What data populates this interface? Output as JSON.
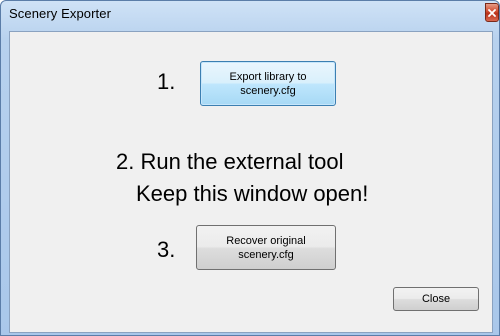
{
  "window": {
    "title": "Scenery Exporter"
  },
  "steps": {
    "step1_number": "1.",
    "export_button_line1": "Export library to",
    "export_button_line2": "scenery.cfg",
    "step2_line1": "2. Run the external tool",
    "step2_line2": "Keep this window open!",
    "step3_number": "3.",
    "recover_button_line1": "Recover original",
    "recover_button_line2": "scenery.cfg"
  },
  "footer": {
    "close_label": "Close"
  },
  "icons": {
    "title_close": "close-icon"
  },
  "colors": {
    "titlebar": "#b7d1ee",
    "close_button": "#cf4a2f",
    "client_bg": "#f0f0f0",
    "focused_button": "#bee6fd"
  }
}
